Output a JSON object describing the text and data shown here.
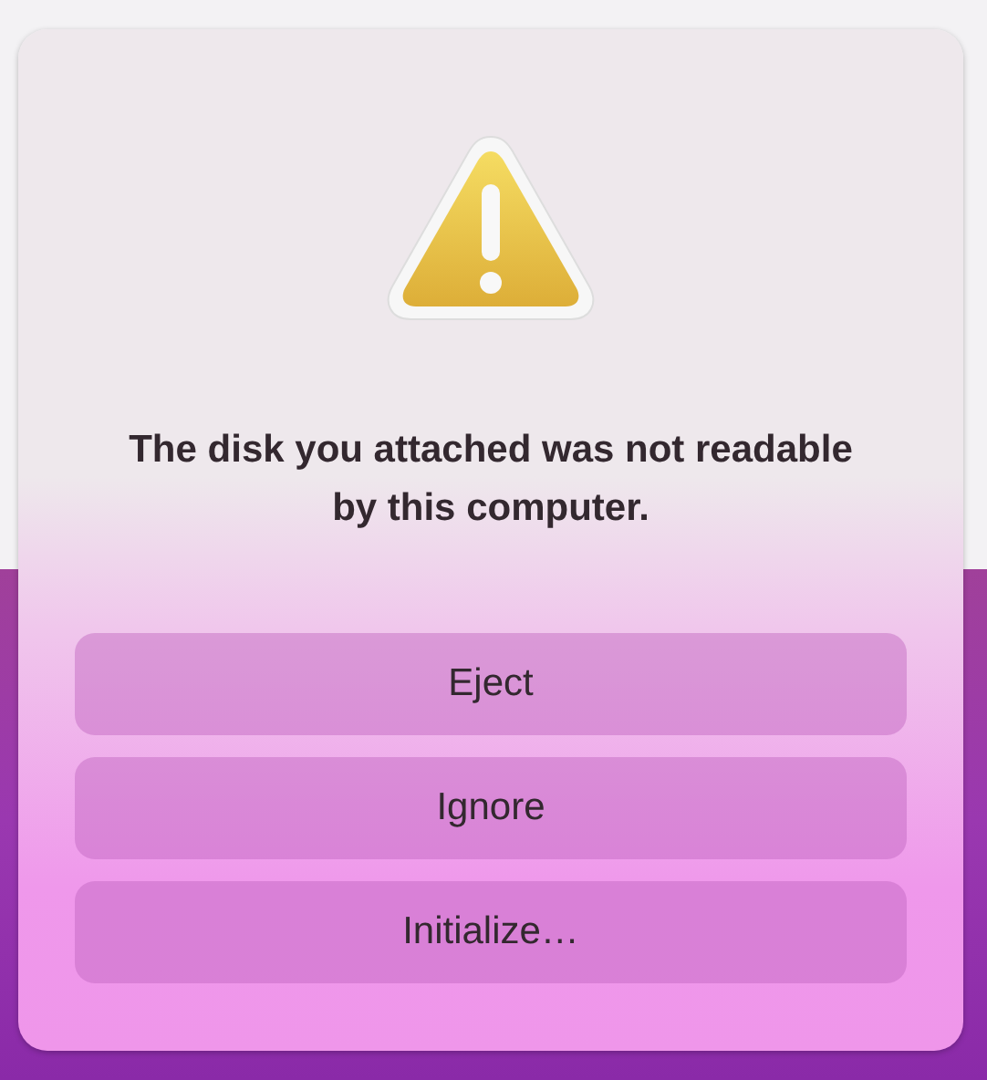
{
  "alert": {
    "message": "The disk you attached was not readable by this computer.",
    "buttons": [
      {
        "label": "Eject"
      },
      {
        "label": "Ignore"
      },
      {
        "label": "Initialize…"
      }
    ]
  }
}
